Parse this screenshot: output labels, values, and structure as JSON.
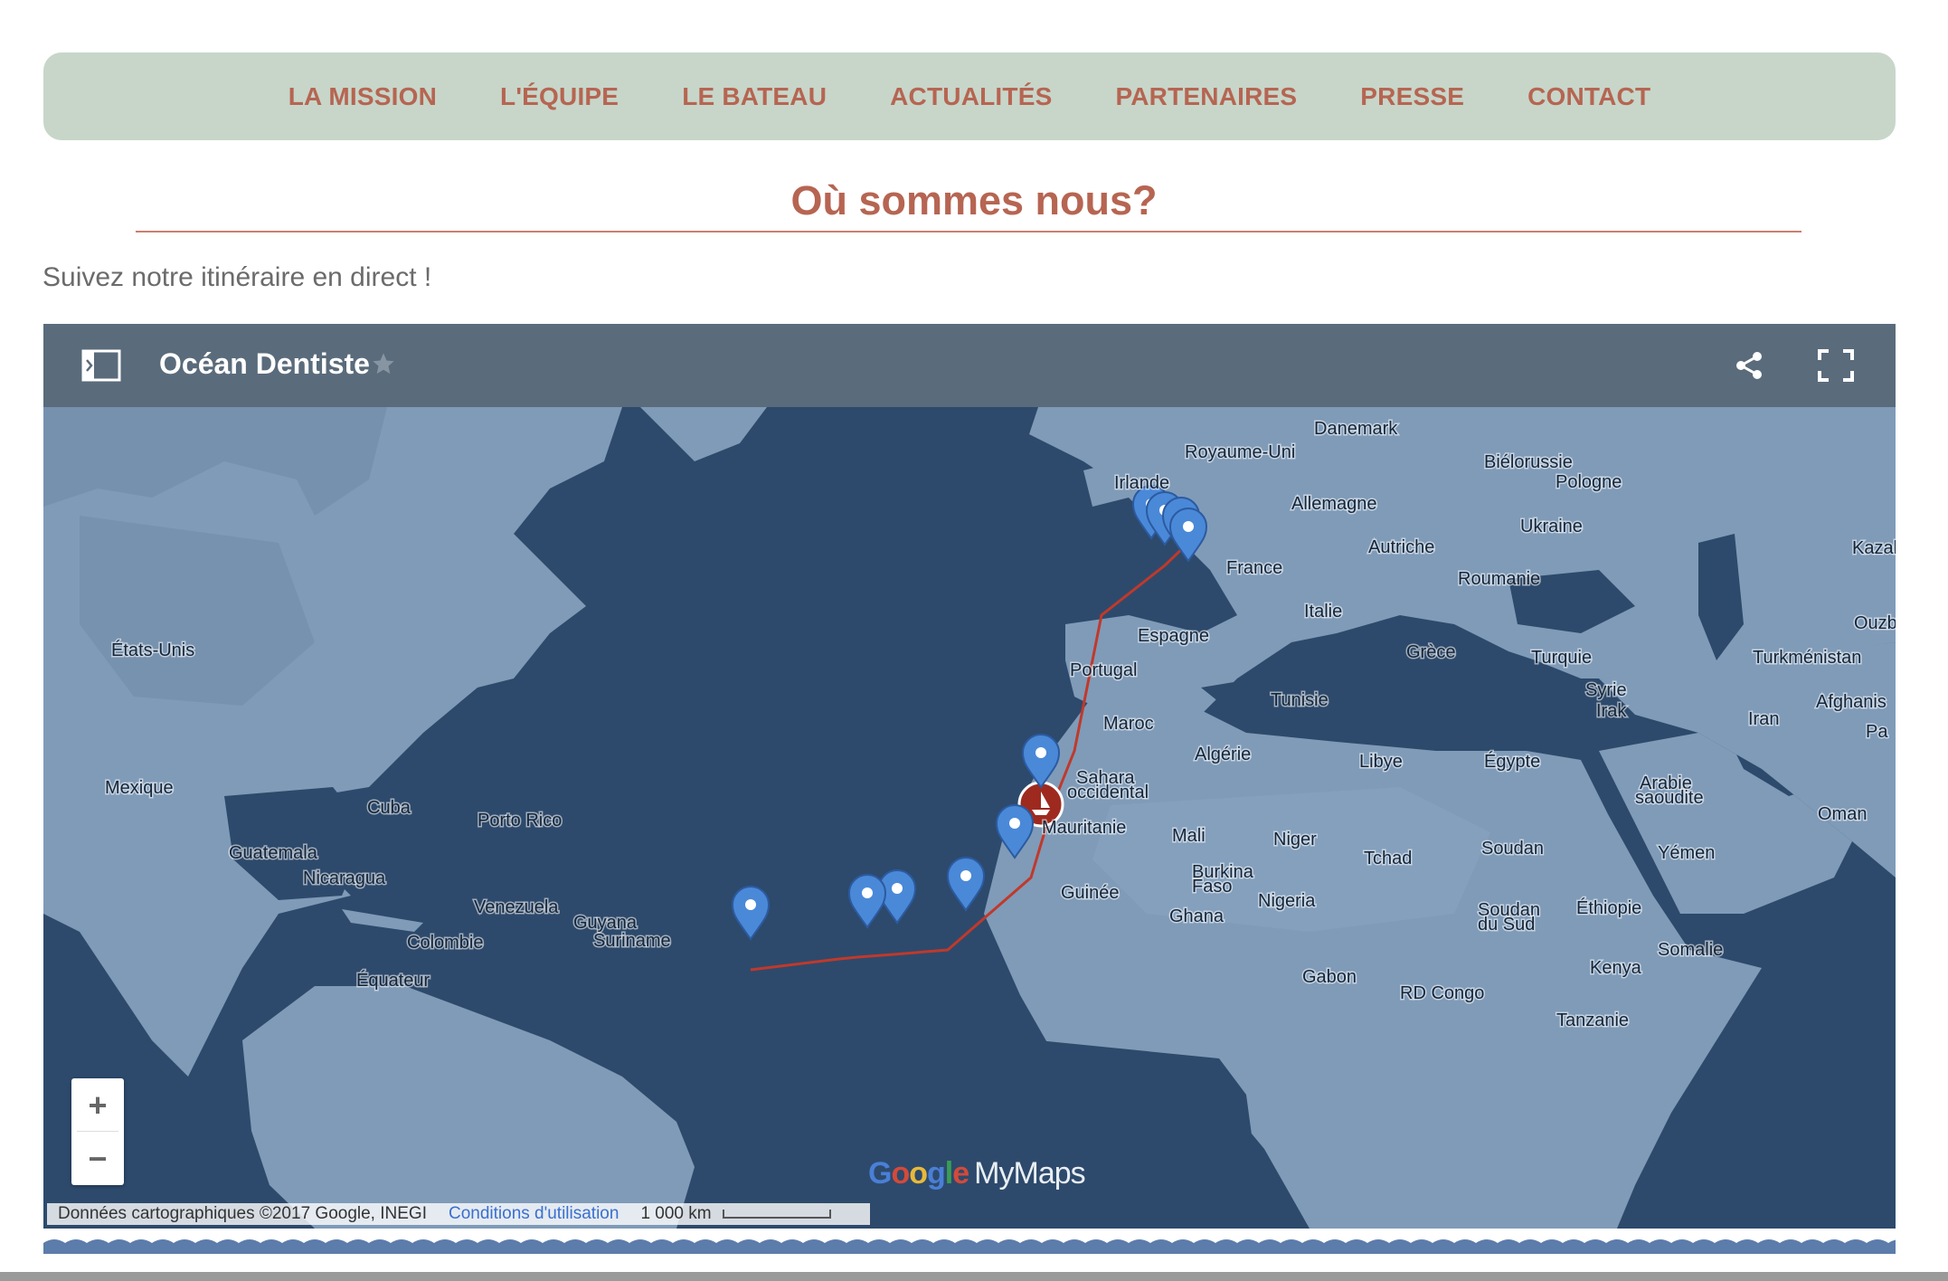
{
  "nav": {
    "items": [
      "LA MISSION",
      "L'ÉQUIPE",
      "LE BATEAU",
      "ACTUALITÉS",
      "PARTENAIRES",
      "PRESSE",
      "CONTACT"
    ]
  },
  "page": {
    "title": "Où sommes nous?",
    "subtitle": "Suivez notre itinéraire en direct !"
  },
  "map": {
    "title": "Océan Dentiste",
    "zoom_in": "+",
    "zoom_out": "−",
    "brand": {
      "google": "Google",
      "mymaps": "MyMaps"
    },
    "footer": {
      "attribution": "Données cartographiques ©2017 Google, INEGI",
      "terms": "Conditions d'utilisation",
      "scale": "1 000 km"
    },
    "icons": {
      "legend": "legend-toggle-icon",
      "star": "star-icon",
      "share": "share-icon",
      "fullscreen": "fullscreen-icon",
      "pin": "map-pin-icon",
      "boat": "boat-icon"
    },
    "colors": {
      "ocean": "#2d4a6c",
      "land": "#7f9bb8",
      "pin": "#4a89d8",
      "route": "#c0392b",
      "boat": "#9e2a1f"
    },
    "labels": [
      "Danemark",
      "Royaume-Uni",
      "Biélorussie",
      "Irlande",
      "Pologne",
      "Allemagne",
      "Ukraine",
      "Autriche",
      "Kazak",
      "France",
      "Roumanie",
      "Italie",
      "Ouzbékista",
      "États-Unis",
      "Espagne",
      "Grèce",
      "Turquie",
      "Turkménistan",
      "Portugal",
      "Syrie",
      "Afghanis",
      "Tunisie",
      "Irak",
      "Iran",
      "Pa",
      "Maroc",
      "Algérie",
      "Libye",
      "Égypte",
      "Sahara",
      "occidental",
      "Arabie",
      "saoudite",
      "Oman",
      "Mexique",
      "Cuba",
      "Porto Rico",
      "Mauritanie",
      "Mali",
      "Niger",
      "Soudan",
      "Yémen",
      "Guatemala",
      "Tchad",
      "Burkina",
      "Faso",
      "Nicaragua",
      "Guinée",
      "Nigeria",
      "Soudan",
      "du Sud",
      "Éthiopie",
      "Ghana",
      "Venezuela",
      "Guyana",
      "Suriname",
      "Colombie",
      "Somalie",
      "Kenya",
      "Gabon",
      "Équateur",
      "RD Congo",
      "Tanzanie"
    ]
  }
}
